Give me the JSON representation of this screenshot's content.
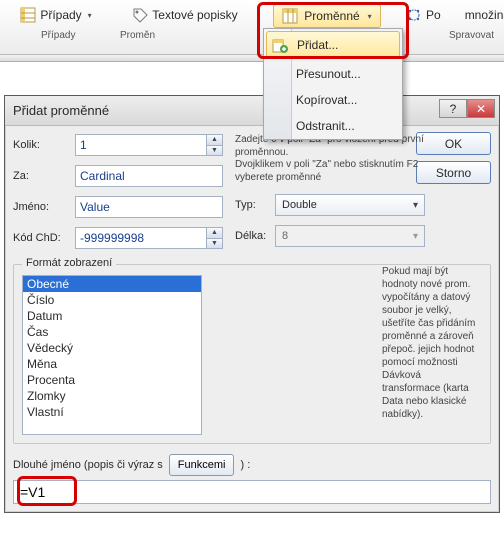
{
  "ribbon": {
    "cases": {
      "label": "Případy",
      "group": "Případy"
    },
    "labels": {
      "label": "Textové popisky",
      "group": "Proměn"
    },
    "vars": {
      "label": "Proměnné"
    },
    "subset": {
      "label": "Po",
      "extra": "množina",
      "group": "Spravovat"
    }
  },
  "menu": {
    "add": "Přidat...",
    "move": "Přesunout...",
    "copy": "Kopírovat...",
    "delete": "Odstranit..."
  },
  "dialog": {
    "title": "Přidat proměnné",
    "help_glyph": "?",
    "close_glyph": "✕",
    "kolik": {
      "label": "Kolik:",
      "value": "1"
    },
    "za": {
      "label": "Za:",
      "value": "Cardinal"
    },
    "jmeno": {
      "label": "Jméno:",
      "value": "Value"
    },
    "kod": {
      "label": "Kód ChD:",
      "value": "-999999998"
    },
    "typ": {
      "label": "Typ:",
      "value": "Double"
    },
    "delka": {
      "label": "Délka:",
      "value": "8"
    },
    "hint_top": "Zadejte 0 v poli \"Za\" pro vložení před první proměnnou.\nDvojklikem v poli \"Za\" nebo stisknutím F2 vyberete proměnné",
    "btn_ok": "OK",
    "btn_storno": "Storno",
    "format": {
      "title": "Formát zobrazení",
      "items": [
        "Obecné",
        "Číslo",
        "Datum",
        "Čas",
        "Vědecký",
        "Měna",
        "Procenta",
        "Zlomky",
        "Vlastní"
      ],
      "selected_index": 0
    },
    "right_hint": "Pokud mají být hodnoty nové prom. vypočítány a datový soubor je velký, ušetříte čas přidáním proměnné a zároveň přepoč. jejich hodnot pomocí možnosti Dávková transformace (karta Data nebo klasické nabídky).",
    "longname": {
      "label_before": "Dlouhé jméno (popis či výraz s",
      "btn": "Funkcemi",
      "label_after": ") :",
      "value": "=V1"
    }
  }
}
